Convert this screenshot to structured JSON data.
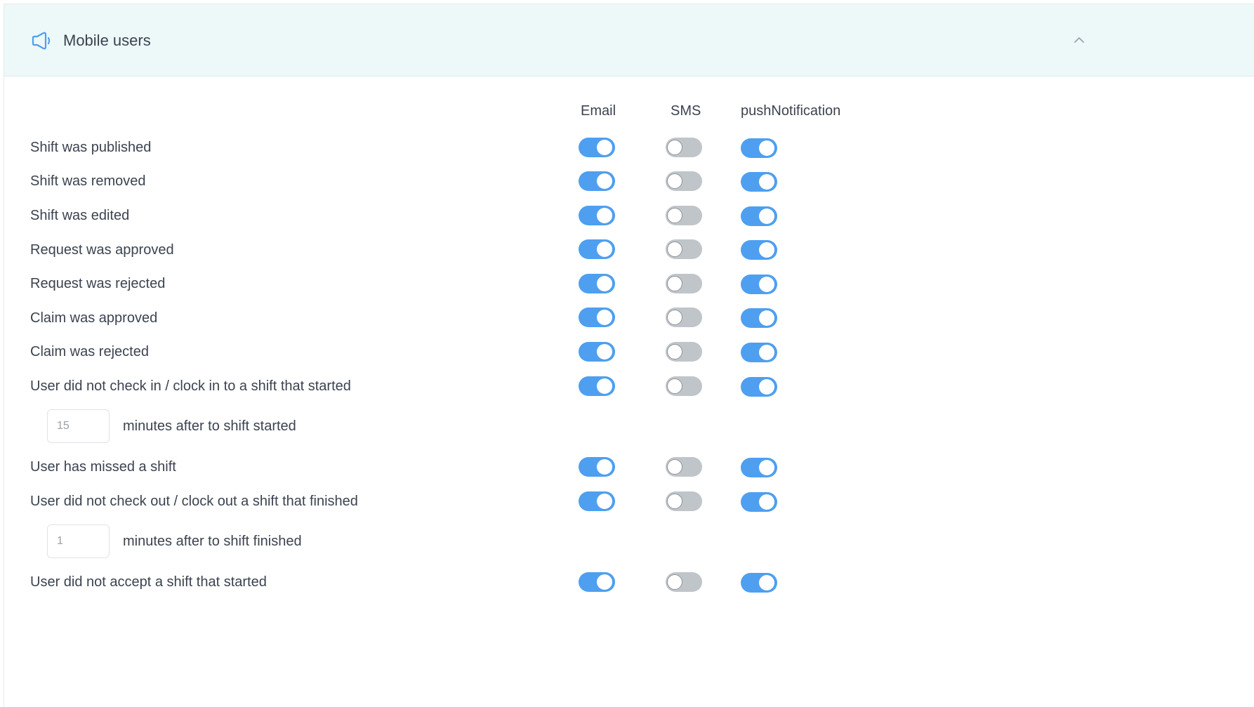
{
  "header": {
    "title": "Mobile users",
    "icon": "megaphone-icon",
    "collapse_icon": "chevron-up-icon"
  },
  "columns": [
    "Email",
    "SMS",
    "pushNotification"
  ],
  "colors": {
    "toggle_on": "#4e9ff0",
    "toggle_off": "#c0c5ca",
    "header_bg": "#edf8f8"
  },
  "rows": [
    {
      "label": "Shift was published",
      "email": true,
      "sms": false,
      "push": true
    },
    {
      "label": "Shift was removed",
      "email": true,
      "sms": false,
      "push": true
    },
    {
      "label": "Shift was edited",
      "email": true,
      "sms": false,
      "push": true
    },
    {
      "label": "Request was approved",
      "email": true,
      "sms": false,
      "push": true
    },
    {
      "label": "Request was rejected",
      "email": true,
      "sms": false,
      "push": true
    },
    {
      "label": "Claim was approved",
      "email": true,
      "sms": false,
      "push": true
    },
    {
      "label": "Claim was rejected",
      "email": true,
      "sms": false,
      "push": true
    },
    {
      "label": "User did not check in / clock in to a shift that started",
      "email": true,
      "sms": false,
      "push": true
    },
    {
      "label": "User has missed a shift",
      "email": true,
      "sms": false,
      "push": true
    },
    {
      "label": "User did not check out / clock out a shift that finished",
      "email": true,
      "sms": false,
      "push": true
    },
    {
      "label": "User did not accept a shift that started",
      "email": true,
      "sms": false,
      "push": true
    }
  ],
  "checkin_delay": {
    "value": "15",
    "label": "minutes after to shift started"
  },
  "checkout_delay": {
    "value": "1",
    "label": "minutes after to shift finished"
  }
}
